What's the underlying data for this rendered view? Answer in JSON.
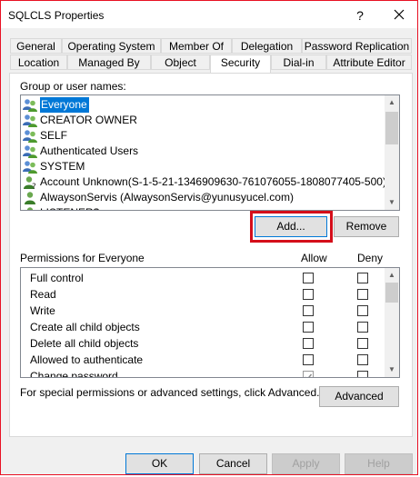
{
  "window": {
    "title": "SQLCLS Properties",
    "help_glyph": "?"
  },
  "tabs_row1": [
    "General",
    "Operating System",
    "Member Of",
    "Delegation",
    "Password Replication"
  ],
  "tabs_row2": [
    "Location",
    "Managed By",
    "Object",
    "Security",
    "Dial-in",
    "Attribute Editor"
  ],
  "active_tab": "Security",
  "groups": {
    "label": "Group or user names:",
    "items": [
      {
        "label": "Everyone",
        "icon": "users-group-icon",
        "selected": true
      },
      {
        "label": "CREATOR OWNER",
        "icon": "users-group-icon"
      },
      {
        "label": "SELF",
        "icon": "users-group-icon"
      },
      {
        "label": "Authenticated Users",
        "icon": "users-group-icon"
      },
      {
        "label": "SYSTEM",
        "icon": "users-group-icon"
      },
      {
        "label": "Account Unknown(S-1-5-21-1346909630-761076055-1808077405-500)",
        "icon": "unknown-user-icon"
      },
      {
        "label": "AlwaysonServis (AlwaysonServis@yunusyucel.com)",
        "icon": "user-icon"
      },
      {
        "label": "LISTENER$",
        "icon": "user-icon"
      }
    ]
  },
  "buttons": {
    "add": "Add...",
    "remove": "Remove",
    "advanced": "Advanced",
    "ok": "OK",
    "cancel": "Cancel",
    "apply": "Apply",
    "help": "Help"
  },
  "permissions": {
    "label": "Permissions for Everyone",
    "allow_header": "Allow",
    "deny_header": "Deny",
    "rows": [
      {
        "name": "Full control",
        "allow": false,
        "deny": false
      },
      {
        "name": "Read",
        "allow": false,
        "deny": false
      },
      {
        "name": "Write",
        "allow": false,
        "deny": false
      },
      {
        "name": "Create all child objects",
        "allow": false,
        "deny": false
      },
      {
        "name": "Delete all child objects",
        "allow": false,
        "deny": false
      },
      {
        "name": "Allowed to authenticate",
        "allow": false,
        "deny": false
      },
      {
        "name": "Change password",
        "allow": true,
        "deny": false
      }
    ]
  },
  "advanced_hint": "For special permissions or advanced settings, click Advanced.",
  "colors": {
    "selection": "#0078d7",
    "highlight_border": "#d40e1a",
    "window_border": "#e81123"
  }
}
